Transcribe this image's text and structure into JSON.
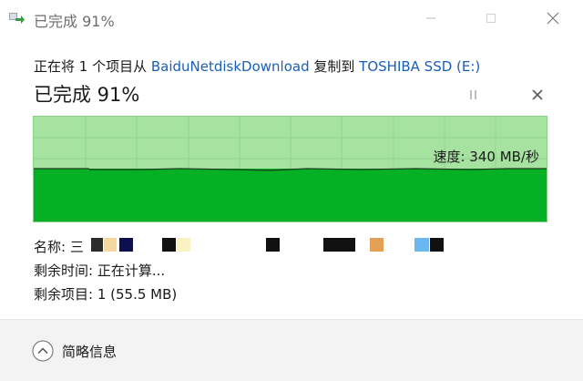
{
  "window": {
    "title": "已完成 91%",
    "icon": "copy-arrow-icon"
  },
  "header": {
    "copy_prefix": "正在将 1 个项目从 ",
    "source": "BaiduNetdiskDownload",
    "copy_middle": " 复制到 ",
    "destination": "TOSHIBA SSD (E:)",
    "progress_text": "已完成 91%",
    "progress_percent": 91
  },
  "graph": {
    "speed": "速度: 340 MB/秒",
    "fill_color": "#06b025",
    "background_color": "#a6e3a1"
  },
  "details": {
    "name_label": "名称: 三",
    "time_label": "剩余时间: 正在计算...",
    "items_label": "剩余项目: 1 (55.5 MB)"
  },
  "footer": {
    "toggle_label": "简略信息",
    "toggle_icon": "chevron-up-circle-icon"
  },
  "colors": {
    "link": "#1a5fb4",
    "progress_green": "#06b025"
  }
}
